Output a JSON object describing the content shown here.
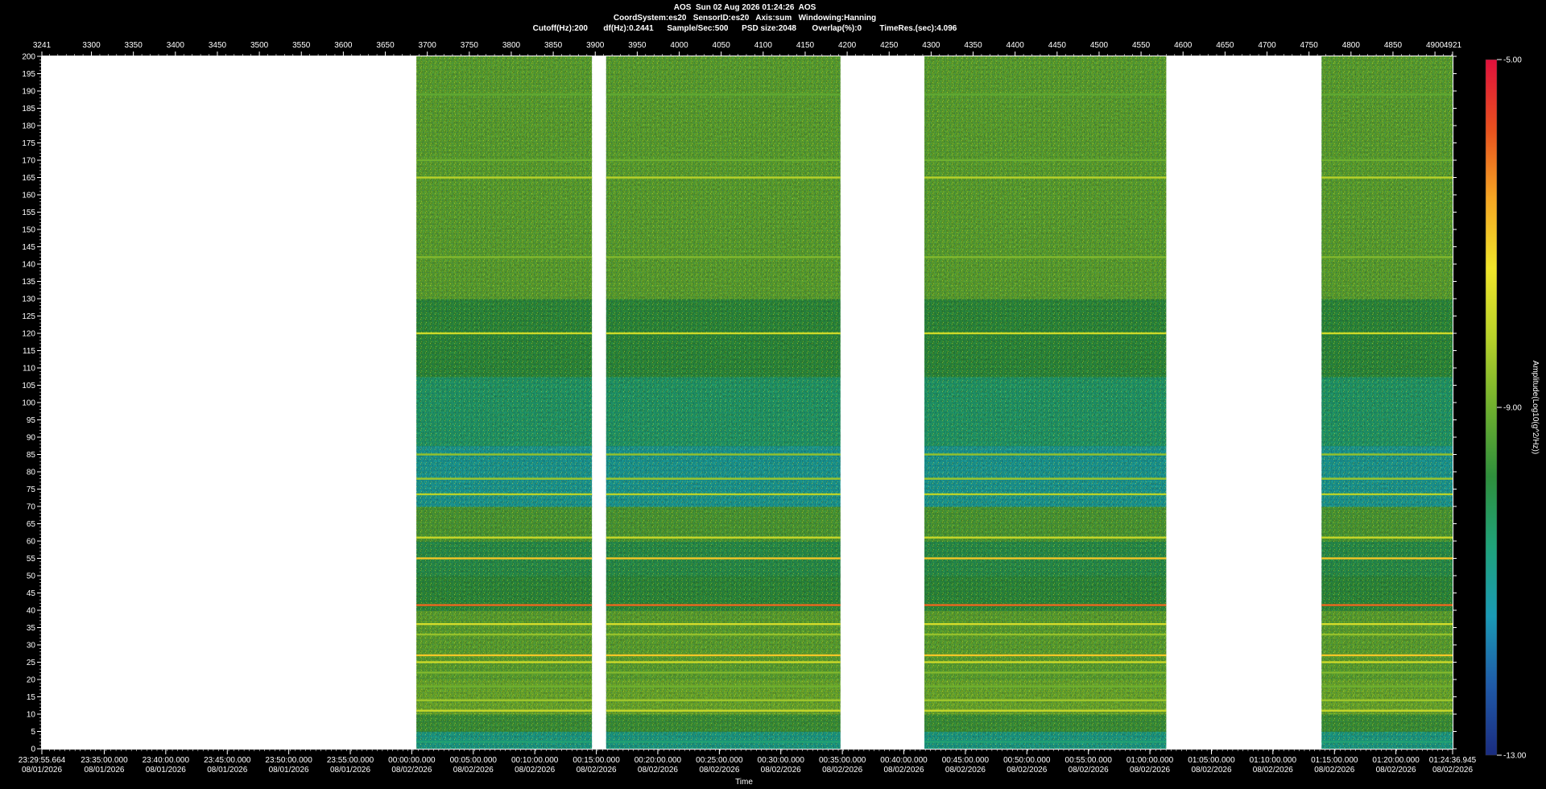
{
  "header": {
    "line1": "AOS  Sun 02 Aug 2026 01:24:26  AOS",
    "line2": "CoordSystem:es20   SensorID:es20   Axis:sum   Windowing:Hanning",
    "line3": "Cutoff(Hz):200       df(Hz):0.2441      Sample/Sec:500      PSD size:2048       Overlap(%):0        TimeRes.(sec):4.096"
  },
  "chart_data": {
    "type": "heatmap",
    "title": "AOS  Sun 02 Aug 2026 01:24:26  AOS",
    "xlabel": "Time",
    "ylabel": "",
    "colorbar_label": "Amplitude(Log10(g^2/Hz))",
    "ylim": [
      0,
      200
    ],
    "y_ticks": [
      0,
      5,
      10,
      15,
      20,
      25,
      30,
      35,
      40,
      45,
      50,
      55,
      60,
      65,
      70,
      75,
      80,
      85,
      90,
      95,
      100,
      105,
      110,
      115,
      120,
      125,
      130,
      135,
      140,
      145,
      150,
      155,
      160,
      165,
      170,
      175,
      180,
      185,
      190,
      195,
      200
    ],
    "top_axis_range": [
      3241,
      4921
    ],
    "top_ticks": [
      3241,
      3300,
      3350,
      3400,
      3450,
      3500,
      3550,
      3600,
      3650,
      3700,
      3750,
      3800,
      3850,
      3900,
      3950,
      4000,
      4050,
      4100,
      4150,
      4200,
      4250,
      4300,
      4350,
      4400,
      4450,
      4500,
      4550,
      4600,
      4650,
      4700,
      4750,
      4800,
      4850,
      4900,
      4921
    ],
    "time_ticks": [
      {
        "time": "23:29:55.664",
        "date": "08/01/2026",
        "top": 3241
      },
      {
        "time": "23:35:00.000",
        "date": "08/01/2026",
        "top": 3315.3
      },
      {
        "time": "23:40:00.000",
        "date": "08/01/2026",
        "top": 3388.5
      },
      {
        "time": "23:45:00.000",
        "date": "08/01/2026",
        "top": 3461.8
      },
      {
        "time": "23:50:00.000",
        "date": "08/01/2026",
        "top": 3535.0
      },
      {
        "time": "23:55:00.000",
        "date": "08/01/2026",
        "top": 3608.3
      },
      {
        "time": "00:00:00.000",
        "date": "08/02/2026",
        "top": 3681.5
      },
      {
        "time": "00:05:00.000",
        "date": "08/02/2026",
        "top": 3754.8
      },
      {
        "time": "00:10:00.000",
        "date": "08/02/2026",
        "top": 3828.0
      },
      {
        "time": "00:15:00.000",
        "date": "08/02/2026",
        "top": 3901.3
      },
      {
        "time": "00:20:00.000",
        "date": "08/02/2026",
        "top": 3974.5
      },
      {
        "time": "00:25:00.000",
        "date": "08/02/2026",
        "top": 4047.8
      },
      {
        "time": "00:30:00.000",
        "date": "08/02/2026",
        "top": 4121.0
      },
      {
        "time": "00:35:00.000",
        "date": "08/02/2026",
        "top": 4194.3
      },
      {
        "time": "00:40:00.000",
        "date": "08/02/2026",
        "top": 4267.5
      },
      {
        "time": "00:45:00.000",
        "date": "08/02/2026",
        "top": 4340.8
      },
      {
        "time": "00:50:00.000",
        "date": "08/02/2026",
        "top": 4414.0
      },
      {
        "time": "00:55:00.000",
        "date": "08/02/2026",
        "top": 4487.3
      },
      {
        "time": "01:00:00.000",
        "date": "08/02/2026",
        "top": 4560.5
      },
      {
        "time": "01:05:00.000",
        "date": "08/02/2026",
        "top": 4633.8
      },
      {
        "time": "01:10:00.000",
        "date": "08/02/2026",
        "top": 4707.0
      },
      {
        "time": "01:15:00.000",
        "date": "08/02/2026",
        "top": 4780.3
      },
      {
        "time": "01:20:00.000",
        "date": "08/02/2026",
        "top": 4853.5
      },
      {
        "time": "01:24:36.945",
        "date": "08/02/2026",
        "top": 4921
      }
    ],
    "data_blocks": [
      {
        "start": 3687,
        "end": 3896
      },
      {
        "start": 3913,
        "end": 4192
      },
      {
        "start": 4292,
        "end": 4580
      },
      {
        "start": 4765,
        "end": 4921
      }
    ],
    "colorbar": {
      "min": -13.0,
      "max": -5.0,
      "ticks": [
        {
          "label": "-5.00",
          "value": -5.0
        },
        {
          "label": "-9.00",
          "value": -9.0
        },
        {
          "label": "-13.00",
          "value": -13.0
        }
      ],
      "colors": [
        "#1a2c80",
        "#1f5aa8",
        "#1a9ab5",
        "#1fa37a",
        "#2e8f3c",
        "#6fb02e",
        "#b8d22a",
        "#f0e52a",
        "#f5a623",
        "#e8501e",
        "#e0103c"
      ]
    },
    "horizontal_lines_hz": [
      {
        "hz": 2,
        "level": -10.5
      },
      {
        "hz": 11,
        "level": -8.0
      },
      {
        "hz": 14,
        "level": -8.5
      },
      {
        "hz": 18,
        "level": -9.0
      },
      {
        "hz": 22,
        "level": -8.8
      },
      {
        "hz": 25,
        "level": -7.9
      },
      {
        "hz": 27,
        "level": -7.0
      },
      {
        "hz": 33,
        "level": -8.6
      },
      {
        "hz": 36,
        "level": -7.8
      },
      {
        "hz": 41.5,
        "level": -6.0
      },
      {
        "hz": 55,
        "level": -7.0
      },
      {
        "hz": 61,
        "level": -8.0
      },
      {
        "hz": 73.5,
        "level": -8.2
      },
      {
        "hz": 78,
        "level": -8.5
      },
      {
        "hz": 85,
        "level": -8.6
      },
      {
        "hz": 120,
        "level": -7.9
      },
      {
        "hz": 142,
        "level": -8.8
      },
      {
        "hz": 165,
        "level": -8.2
      },
      {
        "hz": 170,
        "level": -9.0
      },
      {
        "hz": 189,
        "level": -9.2
      }
    ]
  }
}
